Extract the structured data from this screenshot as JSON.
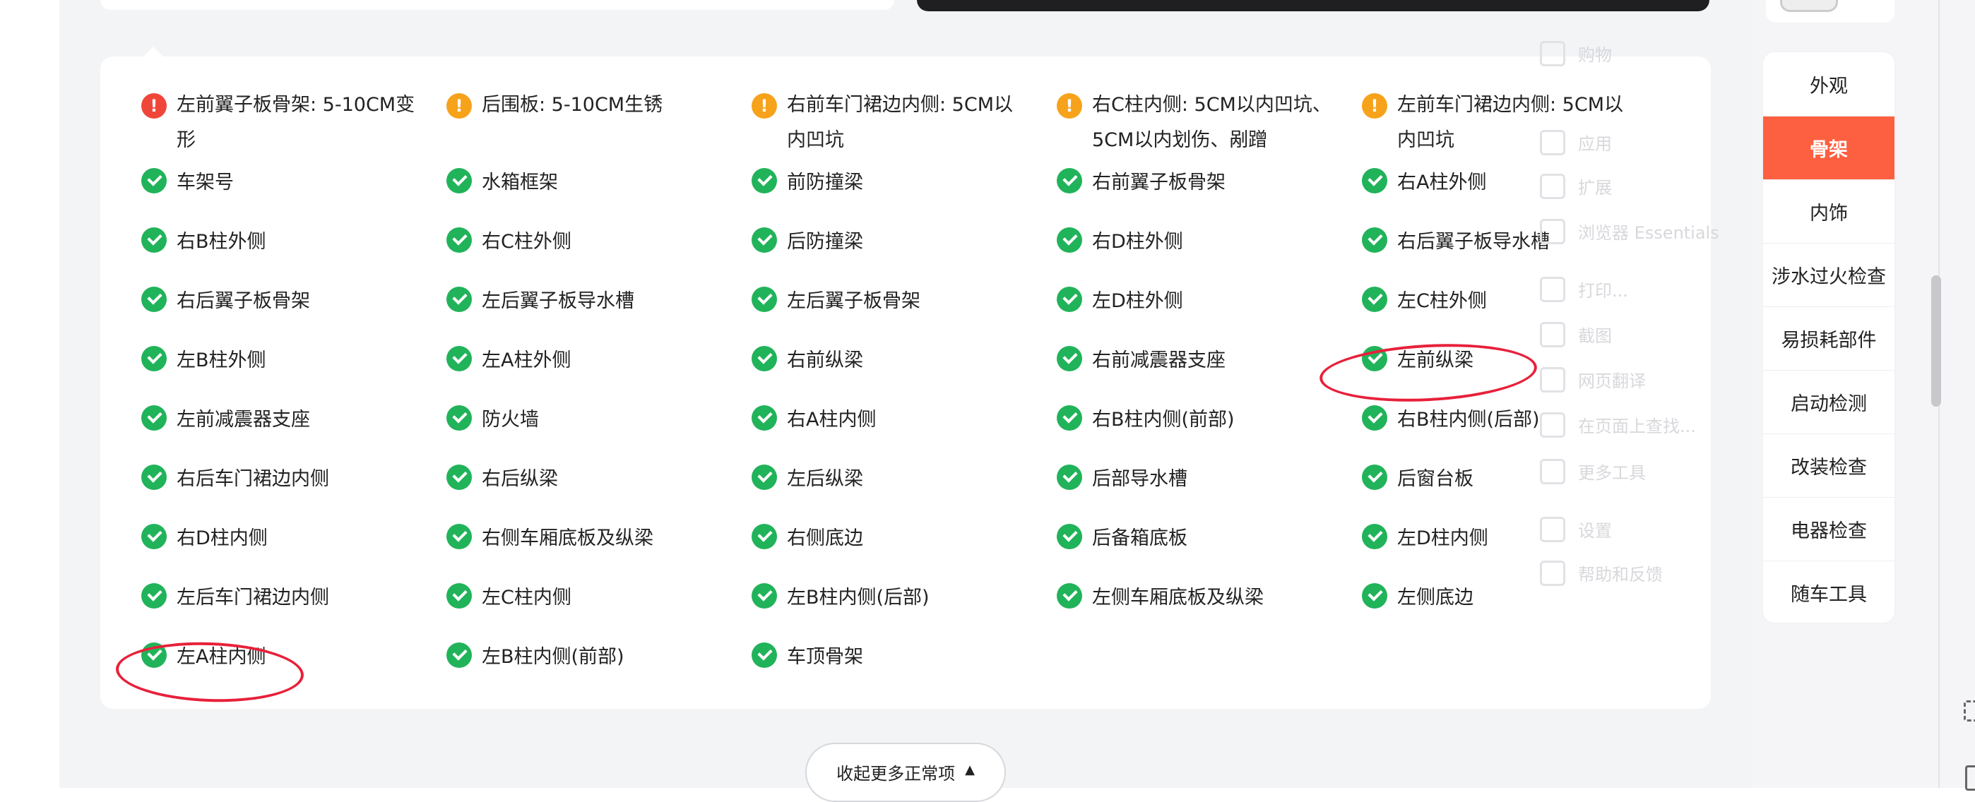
{
  "colors": {
    "accent": "#fd6040",
    "ok": "#21b35a",
    "warn": "#f7a21b",
    "danger": "#f0463a",
    "annotation": "#e8203a"
  },
  "inspection_items": [
    [
      {
        "status": "danger",
        "text": "左前翼子板骨架: 5-10CM变形"
      },
      {
        "status": "warn",
        "text": "后围板: 5-10CM生锈"
      },
      {
        "status": "warn",
        "text": "右前车门裙边内侧: 5CM以内凹坑"
      },
      {
        "status": "warn",
        "text": "右C柱内侧: 5CM以内凹坑、5CM以内划伤、剐蹭"
      },
      {
        "status": "warn",
        "text": "左前车门裙边内侧: 5CM以内凹坑"
      }
    ],
    [
      {
        "status": "ok",
        "text": "车架号"
      },
      {
        "status": "ok",
        "text": "水箱框架"
      },
      {
        "status": "ok",
        "text": "前防撞梁"
      },
      {
        "status": "ok",
        "text": "右前翼子板骨架"
      },
      {
        "status": "ok",
        "text": "右A柱外侧"
      }
    ],
    [
      {
        "status": "ok",
        "text": "右B柱外侧"
      },
      {
        "status": "ok",
        "text": "右C柱外侧"
      },
      {
        "status": "ok",
        "text": "后防撞梁"
      },
      {
        "status": "ok",
        "text": "右D柱外侧"
      },
      {
        "status": "ok",
        "text": "右后翼子板导水槽"
      }
    ],
    [
      {
        "status": "ok",
        "text": "右后翼子板骨架"
      },
      {
        "status": "ok",
        "text": "左后翼子板导水槽"
      },
      {
        "status": "ok",
        "text": "左后翼子板骨架"
      },
      {
        "status": "ok",
        "text": "左D柱外侧"
      },
      {
        "status": "ok",
        "text": "左C柱外侧"
      }
    ],
    [
      {
        "status": "ok",
        "text": "左B柱外侧"
      },
      {
        "status": "ok",
        "text": "左A柱外侧"
      },
      {
        "status": "ok",
        "text": "右前纵梁"
      },
      {
        "status": "ok",
        "text": "右前减震器支座"
      },
      {
        "status": "ok",
        "text": "左前纵梁"
      }
    ],
    [
      {
        "status": "ok",
        "text": "左前减震器支座"
      },
      {
        "status": "ok",
        "text": "防火墙"
      },
      {
        "status": "ok",
        "text": "右A柱内侧"
      },
      {
        "status": "ok",
        "text": "右B柱内侧(前部)"
      },
      {
        "status": "ok",
        "text": "右B柱内侧(后部)"
      }
    ],
    [
      {
        "status": "ok",
        "text": "右后车门裙边内侧"
      },
      {
        "status": "ok",
        "text": "右后纵梁"
      },
      {
        "status": "ok",
        "text": "左后纵梁"
      },
      {
        "status": "ok",
        "text": "后部导水槽"
      },
      {
        "status": "ok",
        "text": "后窗台板"
      }
    ],
    [
      {
        "status": "ok",
        "text": "右D柱内侧"
      },
      {
        "status": "ok",
        "text": "右侧车厢底板及纵梁"
      },
      {
        "status": "ok",
        "text": "右侧底边"
      },
      {
        "status": "ok",
        "text": "后备箱底板"
      },
      {
        "status": "ok",
        "text": "左D柱内侧"
      }
    ],
    [
      {
        "status": "ok",
        "text": "左后车门裙边内侧"
      },
      {
        "status": "ok",
        "text": "左C柱内侧"
      },
      {
        "status": "ok",
        "text": "左B柱内侧(后部)"
      },
      {
        "status": "ok",
        "text": "左侧车厢底板及纵梁"
      },
      {
        "status": "ok",
        "text": "左侧底边"
      }
    ],
    [
      {
        "status": "ok",
        "text": "左A柱内侧"
      },
      {
        "status": "ok",
        "text": "左B柱内侧(前部)"
      },
      {
        "status": "ok",
        "text": "车顶骨架"
      }
    ]
  ],
  "collapse_button": {
    "label": "收起更多正常项",
    "icon": "caret-up-icon"
  },
  "side_nav": {
    "active_index": 1,
    "items": [
      "外观",
      "骨架",
      "内饰",
      "涉水过火检查",
      "易损耗部件",
      "启动检测",
      "改装检查",
      "电器检查",
      "随车工具"
    ]
  },
  "background_menu": {
    "items": [
      "购物",
      "应用",
      "扩展",
      "浏览器 Essentials",
      "打印...",
      "截图",
      "网页翻译",
      "在页面上查找...",
      "更多工具",
      "设置",
      "帮助和反馈"
    ]
  }
}
